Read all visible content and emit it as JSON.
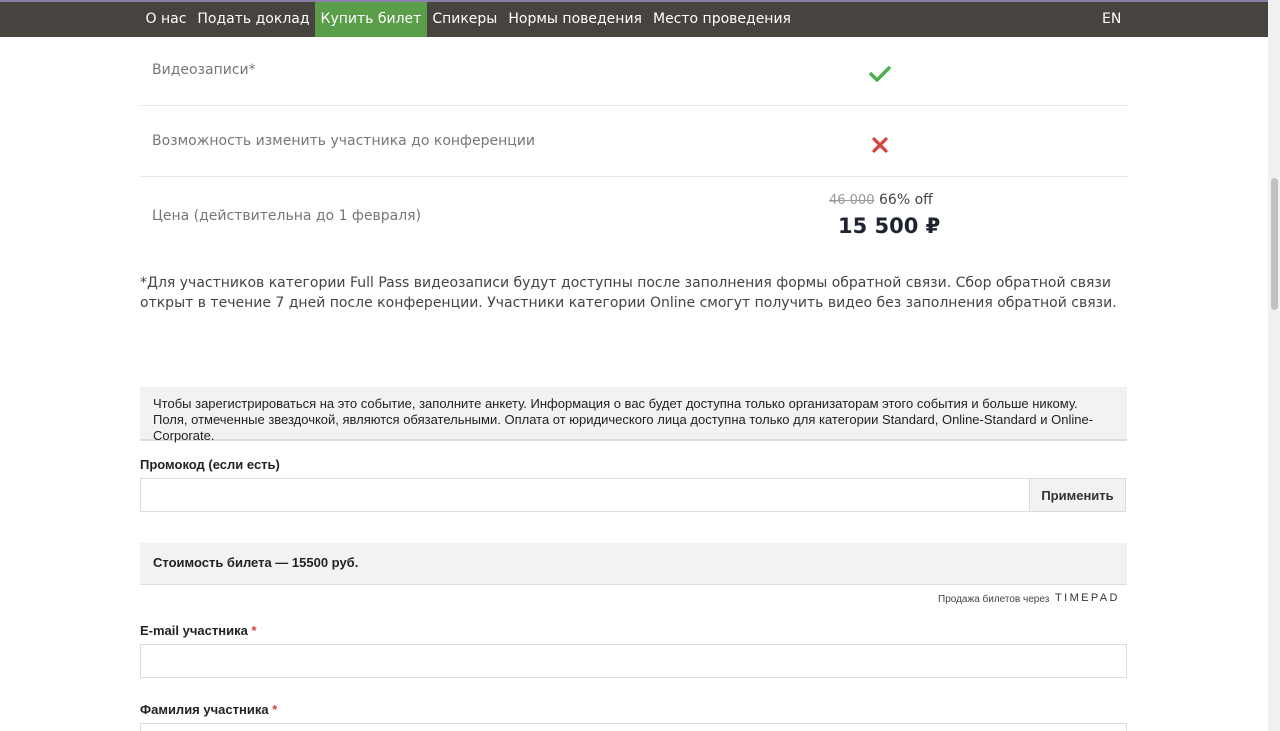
{
  "nav": {
    "items": [
      {
        "label": "О нас"
      },
      {
        "label": "Подать доклад"
      },
      {
        "label": "Купить билет"
      },
      {
        "label": "Спикеры"
      },
      {
        "label": "Нормы поведения"
      },
      {
        "label": "Место проведения"
      }
    ],
    "active_item": "Купить билет",
    "lang": "EN"
  },
  "features": [
    {
      "label": "Видеозаписи*",
      "available": true
    },
    {
      "label": "Возможность изменить участника до конференции",
      "available": false
    }
  ],
  "price_row": {
    "label": "Цена (действительна до 1 февраля)",
    "old_price": "46 000",
    "discount": "66% off",
    "new_price": "15 500 ₽"
  },
  "footnote": "*Для участников категории Full Pass видеозаписи будут доступны после заполнения формы обратной связи. Сбор обратной связи открыт в течение 7 дней после конференции. Участники категории Online смогут получить видео без заполнения обратной связи.",
  "form": {
    "info": "Чтобы зарегистрироваться на это событие, заполните анкету. Информация о вас будет доступна только организаторам этого события и больше никому. Поля, отмеченные звездочкой, являются обязательными. Оплата от юридического лица доступна только для категории Standard, Online-Standard и Online-Corporate.",
    "promo_label": "Промокод (если есть)",
    "promo_value": "",
    "apply_label": "Применить",
    "cost_text": "Стоимость билета — 15500 руб.",
    "sales_note": "Продажа билетов через",
    "timepad": "TIMEPAD",
    "email_label": "E-mail участника",
    "email_value": "",
    "surname_label": "Фамилия участника",
    "surname_value": "",
    "required_mark": "*"
  },
  "colors": {
    "topbar": "#47433f",
    "nav_active": "#5b9e4a",
    "check": "#4cae4c",
    "cross": "#d9403a",
    "required": "#d0463c"
  }
}
